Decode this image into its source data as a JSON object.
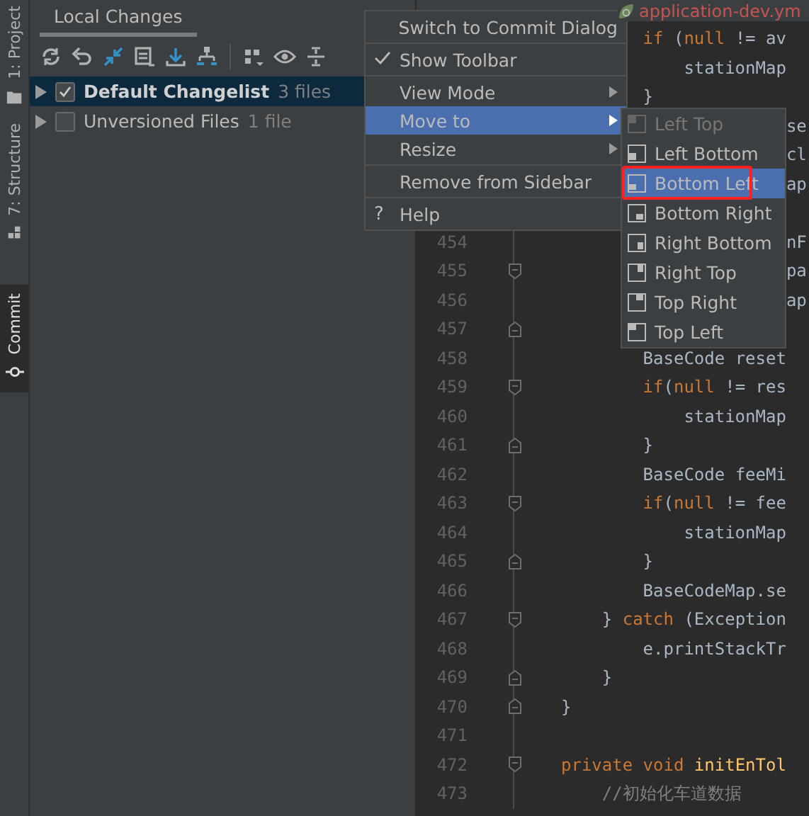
{
  "tool_strip": [
    {
      "label": "1: Project",
      "selected": false
    },
    {
      "label": "7: Structure",
      "selected": false
    },
    {
      "label": "Commit",
      "selected": true
    }
  ],
  "panel": {
    "tab": "Local Changes",
    "tree": [
      {
        "label": "Default Changelist",
        "count": "3 files",
        "checked": true,
        "selected": true,
        "default": true
      },
      {
        "label": "Unversioned Files",
        "count": "1 file",
        "checked": false,
        "selected": false,
        "default": false
      }
    ]
  },
  "editor": {
    "tab": {
      "title": "application-dev.ym",
      "modified": true
    },
    "lines": [
      {
        "code": [
          {
            "kind": "keyword",
            "text": "        if"
          },
          {
            "kind": "plain",
            "text": " ("
          },
          {
            "kind": "keyword",
            "text": "null"
          },
          {
            "kind": "plain",
            "text": " != av"
          }
        ]
      },
      {
        "code": [
          {
            "kind": "plain",
            "text": "            stationMap"
          }
        ]
      },
      {
        "code": [
          {
            "kind": "plain",
            "text": "        }"
          }
        ]
      },
      {
        "code": [
          {
            "kind": "plain",
            "text": "                      se"
          }
        ]
      },
      {
        "code": [
          {
            "kind": "plain",
            "text": "                      cl"
          }
        ]
      },
      {
        "code": [
          {
            "kind": "plain",
            "text": "                      ap"
          }
        ]
      },
      {
        "kind": "blank"
      },
      {
        "number": "454",
        "code": [
          {
            "kind": "plain",
            "text": "                      nF"
          }
        ]
      },
      {
        "number": "455",
        "fold": {
          "kind": "start"
        },
        "code": [
          {
            "kind": "plain",
            "text": "                      pa"
          }
        ]
      },
      {
        "number": "456",
        "code": [
          {
            "kind": "plain",
            "text": "                      ap"
          }
        ]
      },
      {
        "number": "457",
        "fold": {
          "kind": "end"
        }
      },
      {
        "number": "458",
        "code": [
          {
            "kind": "plain",
            "text": "        BaseCode reset"
          }
        ]
      },
      {
        "number": "459",
        "fold": {
          "kind": "start"
        },
        "code": [
          {
            "kind": "keyword",
            "text": "        if"
          },
          {
            "kind": "plain",
            "text": "("
          },
          {
            "kind": "keyword",
            "text": "null"
          },
          {
            "kind": "plain",
            "text": " != res"
          }
        ]
      },
      {
        "number": "460",
        "code": [
          {
            "kind": "plain",
            "text": "            stationMap"
          }
        ]
      },
      {
        "number": "461",
        "fold": {
          "kind": "end"
        },
        "code": [
          {
            "kind": "plain",
            "text": "        }"
          }
        ]
      },
      {
        "number": "462",
        "code": [
          {
            "kind": "plain",
            "text": "        BaseCode feeMi"
          }
        ]
      },
      {
        "number": "463",
        "fold": {
          "kind": "start"
        },
        "code": [
          {
            "kind": "keyword",
            "text": "        if"
          },
          {
            "kind": "plain",
            "text": "("
          },
          {
            "kind": "keyword",
            "text": "null"
          },
          {
            "kind": "plain",
            "text": " != fee"
          }
        ]
      },
      {
        "number": "464",
        "code": [
          {
            "kind": "plain",
            "text": "            stationMap"
          }
        ]
      },
      {
        "number": "465",
        "fold": {
          "kind": "end"
        },
        "code": [
          {
            "kind": "plain",
            "text": "        }"
          }
        ]
      },
      {
        "number": "466",
        "code": [
          {
            "kind": "plain",
            "text": "        BaseCodeMap.se"
          }
        ]
      },
      {
        "number": "467",
        "fold": {
          "kind": "start"
        },
        "code": [
          {
            "kind": "plain",
            "text": "    }"
          },
          {
            "kind": "keyword",
            "text": " catch"
          },
          {
            "kind": "plain",
            "text": " (Exception"
          }
        ]
      },
      {
        "number": "468",
        "code": [
          {
            "kind": "plain",
            "text": "        e.printStackTr"
          }
        ]
      },
      {
        "number": "469",
        "fold": {
          "kind": "end"
        },
        "code": [
          {
            "kind": "plain",
            "text": "    }"
          }
        ]
      },
      {
        "number": "470",
        "fold": {
          "kind": "end"
        },
        "code": [
          {
            "kind": "plain",
            "text": "}"
          }
        ]
      },
      {
        "number": "471"
      },
      {
        "number": "472",
        "fold": {
          "kind": "start"
        },
        "code": [
          {
            "kind": "keyword",
            "text": "private"
          },
          {
            "kind": "keyword",
            "text": " void"
          },
          {
            "kind": "method",
            "text": " initEnTol"
          }
        ]
      },
      {
        "number": "473",
        "code": [
          {
            "kind": "comment",
            "text": "    //初始化车道数据"
          }
        ]
      }
    ]
  },
  "context_menu": [
    {
      "kind": "item",
      "label": "Switch to Commit Dialog",
      "checked": false,
      "submenu": false,
      "selected": false
    },
    {
      "kind": "separator"
    },
    {
      "kind": "item",
      "label": "Show Toolbar",
      "checked": true,
      "submenu": false,
      "selected": false
    },
    {
      "kind": "separator"
    },
    {
      "kind": "item",
      "label": "View Mode",
      "checked": false,
      "submenu": true,
      "selected": false
    },
    {
      "kind": "item",
      "label": "Move to",
      "checked": false,
      "submenu": true,
      "selected": true
    },
    {
      "kind": "item",
      "label": "Resize",
      "checked": false,
      "submenu": true,
      "selected": false
    },
    {
      "kind": "separator"
    },
    {
      "kind": "item",
      "label": "Remove from Sidebar",
      "checked": false,
      "submenu": false,
      "selected": false
    },
    {
      "kind": "separator"
    },
    {
      "kind": "item",
      "label": "Help",
      "glyph": "?",
      "checked": false,
      "submenu": false,
      "selected": false
    }
  ],
  "submenu": [
    {
      "label": "Left Top",
      "disabled": true,
      "selected": false,
      "annotated": false
    },
    {
      "label": "Left Bottom",
      "disabled": false,
      "selected": false,
      "annotated": false
    },
    {
      "label": "Bottom Left",
      "disabled": false,
      "selected": true,
      "annotated": true
    },
    {
      "label": "Bottom Right",
      "disabled": false,
      "selected": false,
      "annotated": false
    },
    {
      "label": "Right Bottom",
      "disabled": false,
      "selected": false,
      "annotated": false
    },
    {
      "label": "Right Top",
      "disabled": false,
      "selected": false,
      "annotated": false
    },
    {
      "label": "Top Right",
      "disabled": false,
      "selected": false,
      "annotated": false
    },
    {
      "label": "Top Left",
      "disabled": false,
      "selected": false,
      "annotated": false
    }
  ]
}
